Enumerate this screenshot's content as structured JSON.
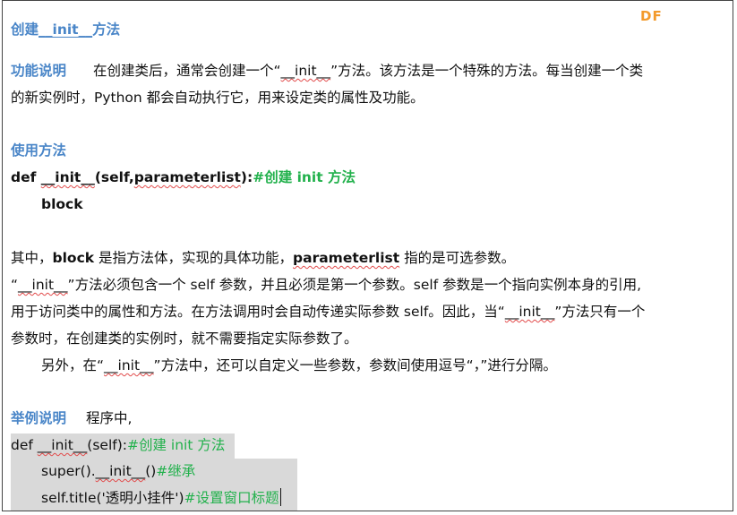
{
  "logo": "DF",
  "title": {
    "pre": "创建",
    "kw": "__init__",
    "post": "方法"
  },
  "func": {
    "label": "功能说明",
    "line1_a": "在创建类后，通常会创建一个“",
    "line1_kw": "__init__",
    "line1_b": "”方法。该方法是一个特殊的方法。每当创建一个类",
    "line2": "的新实例时，Python 都会自动执行它，用来设定类的属性及功能。"
  },
  "usage": {
    "label": "使用方法",
    "code_def": "def ",
    "code_kw": "__init__",
    "code_a": "(self,",
    "code_param": "parameterlist",
    "code_b": "):",
    "code_comment": "#创建 init 方法",
    "code_block": "block"
  },
  "explain": {
    "l1_a": "其中，",
    "l1_block": "block",
    "l1_b": " 是指方法体，实现的具体功能，",
    "l1_param": "parameterlist",
    "l1_c": " 指的是可选参数。",
    "l2_a": "“",
    "l2_kw": "__init__",
    "l2_b": "”方法必须包含一个 self 参数，并且必须是第一个参数。self 参数是一个指向实例本身的引用,",
    "l3_a": "用于访问类中的属性和方法。在方法调用时会自动传递实际参数 self。因此，当“",
    "l3_kw": "__init__",
    "l3_b": "”方法只有一个",
    "l4": "参数时，在创建类的实例时，就不需要指定实际参数了。",
    "l5_a": "另外，在“",
    "l5_kw": "__init__",
    "l5_b": "”方法中，还可以自定义一些参数，参数间使用逗号“，”进行分隔。"
  },
  "example": {
    "label": "举例说明",
    "intro": "程序中,",
    "c1_def": "def ",
    "c1_kw": "__init__",
    "c1_a": "(self):",
    "c1_comment": "#创建 init 方法",
    "c2_a": "super().",
    "c2_kw": "__init__",
    "c2_b": "()",
    "c2_comment": "#继承",
    "c3_a": "self.title('透明小挂件')",
    "c3_comment": "#设置窗口标题"
  }
}
